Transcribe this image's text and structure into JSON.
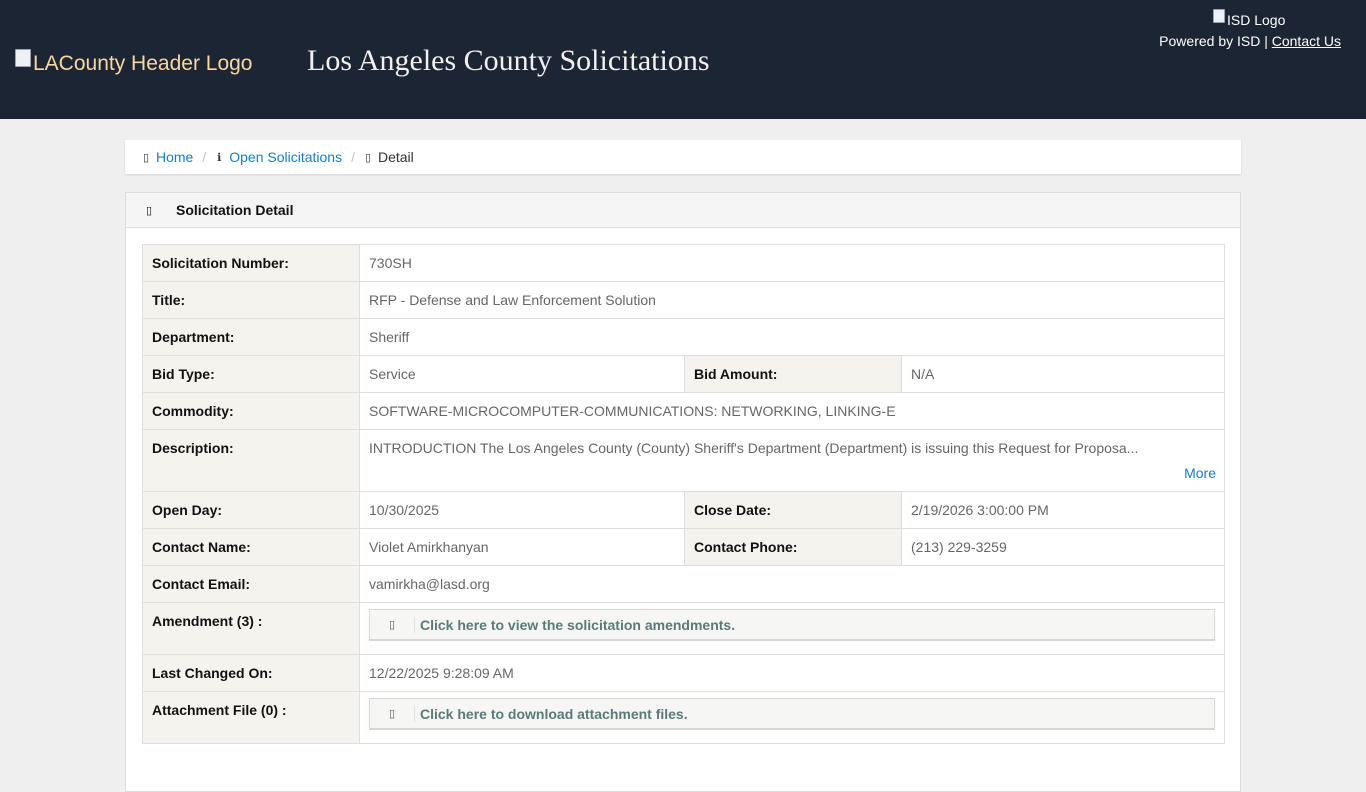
{
  "header": {
    "la_logo_alt": "LACounty Header Logo",
    "site_title": "Los Angeles County Solicitations",
    "isd_logo_alt": "ISD Logo",
    "powered_by": "Powered by ISD |",
    "contact_us": "Contact Us"
  },
  "breadcrumb": {
    "home": "Home",
    "open_solicitations": "Open Solicitations",
    "detail": "Detail",
    "separator": "/"
  },
  "panel": {
    "title": "Solicitation Detail"
  },
  "detail": {
    "solicitation_number_label": "Solicitation Number:",
    "solicitation_number": "730SH",
    "title_label": "Title:",
    "title": "RFP - Defense and Law Enforcement Solution",
    "department_label": "Department:",
    "department": "Sheriff",
    "bid_type_label": "Bid Type:",
    "bid_type": "Service",
    "bid_amount_label": "Bid Amount:",
    "bid_amount": "N/A",
    "commodity_label": "Commodity:",
    "commodity": "SOFTWARE-MICROCOMPUTER-COMMUNICATIONS: NETWORKING, LINKING-E",
    "description_label": "Description:",
    "description": "INTRODUCTION The Los Angeles County (County) Sheriff's Department (Department) is issuing this Request for Proposa...",
    "more_link": "More",
    "open_day_label": "Open Day:",
    "open_day": "10/30/2025",
    "close_date_label": "Close Date:",
    "close_date": "2/19/2026 3:00:00 PM",
    "contact_name_label": "Contact Name:",
    "contact_name": "Violet Amirkhanyan",
    "contact_phone_label": "Contact Phone:",
    "contact_phone": "(213) 229-3259",
    "contact_email_label": "Contact Email:",
    "contact_email": "vamirkha@lasd.org",
    "amendment_label": "Amendment (3) :",
    "amendment_link": "Click here to view the solicitation amendments.",
    "last_changed_label": "Last Changed On:",
    "last_changed": "12/22/2025 9:28:09 AM",
    "attachment_label": "Attachment File (0) :",
    "attachment_link": "Click here to download attachment files."
  },
  "icons": {
    "home": "home-icon",
    "info": "info-icon",
    "detail": "document-icon",
    "panel": "list-icon",
    "amendment": "file-icon",
    "attachment": "download-icon"
  },
  "colors": {
    "header_bg": "#1b2533",
    "link": "#1a7bc8",
    "label_bg": "#f4f3ee",
    "action_link": "#5a7a78"
  }
}
